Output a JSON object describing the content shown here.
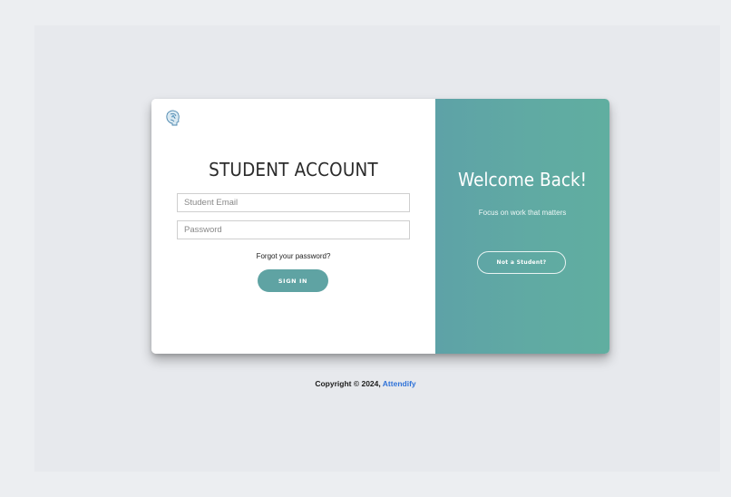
{
  "login_card": {
    "title": "STUDENT ACCOUNT",
    "email_placeholder": "Student Email",
    "password_placeholder": "Password",
    "forgot_password": "Forgot your password?",
    "sign_in": "SIGN IN",
    "logo_icon": "student-head-logo-icon"
  },
  "welcome_panel": {
    "heading": "Welcome Back!",
    "tagline": "Focus on work that matters",
    "not_student": "Not a Student?"
  },
  "footer": {
    "copyright": "Copyright © 2024,",
    "brand": "Attendify"
  },
  "colors": {
    "accent": "#5fa3a3",
    "link": "#2f72d8",
    "page_background": "#eceef1"
  }
}
